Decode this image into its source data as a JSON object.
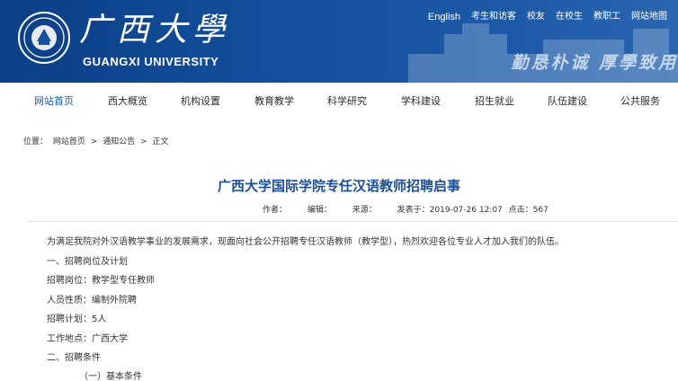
{
  "header": {
    "logo_cn": "广西大學",
    "logo_en": "GUANGXI UNIVERSITY",
    "top_links": [
      "English",
      "考生和访客",
      "校友",
      "在校生",
      "教职工",
      "网站地图"
    ],
    "motto": "勤恳朴诚 厚學致用"
  },
  "nav": {
    "items": [
      "网站首页",
      "西大概览",
      "机构设置",
      "教育教学",
      "科学研究",
      "学科建设",
      "招生就业",
      "队伍建设",
      "公共服务"
    ]
  },
  "breadcrumb": {
    "prefix": "位置：",
    "home": "网站首页",
    "sep1": ">",
    "section": "通知公告",
    "sep2": ">",
    "current": "正文"
  },
  "article": {
    "title": "广西大学国际学院专任汉语教师招聘启事",
    "author_label": "作者：",
    "editor_label": "编辑：",
    "source_label": "来源：",
    "published": "发表于：2019-07-26 12:07",
    "clicks": "点击：567",
    "paragraphs": [
      "为满足我院对外汉语教学事业的发展需求，现面向社会公开招聘专任汉语教师（教学型），热烈欢迎各位专业人才加入我们的队伍。",
      "一、招聘岗位及计划",
      "招聘岗位：教学型专任教师",
      "人员性质：编制外院聘",
      "招聘计划：5人",
      "工作地点：广西大学",
      "二、招聘条件",
      "（一）基本条件"
    ]
  },
  "colors": {
    "header_bg": "#14519e",
    "title": "#1d4f93",
    "nav_active": "#1d5ba8"
  }
}
